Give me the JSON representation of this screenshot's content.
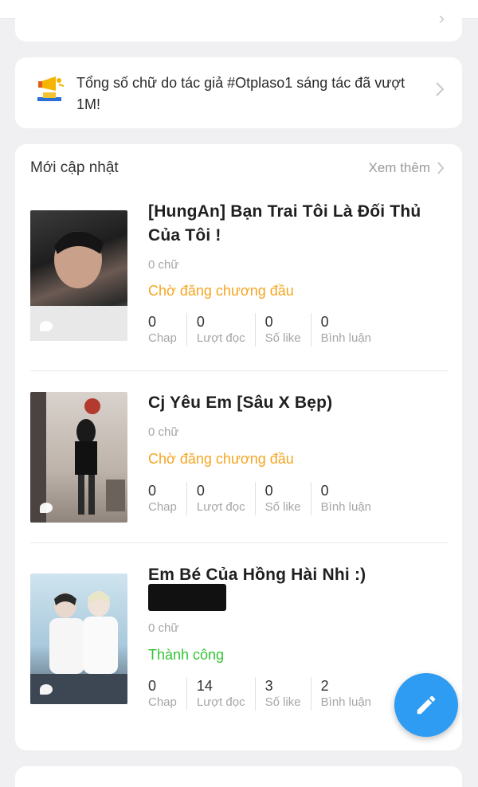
{
  "announcement": {
    "text": "Tổng số chữ do tác giả #Otplaso1 sáng tác đã vượt 1M!"
  },
  "updates": {
    "heading": "Mới cập nhật",
    "see_more": "Xem thêm"
  },
  "stat_labels": {
    "chap": "Chap",
    "reads": "Lượt đọc",
    "likes": "Số like",
    "comments": "Bình luận"
  },
  "stories": [
    {
      "title": "[HungAn] Bạn Trai Tôi Là Đối Thủ Của Tôi !",
      "words": "0 chữ",
      "status": "Chờ đăng chương đầu",
      "chap": "0",
      "reads": "0",
      "likes": "0",
      "comments": "0"
    },
    {
      "title": "Cj Yêu Em [Sâu X Bẹp)",
      "words": "0 chữ",
      "status": "Chờ đăng chương đầu",
      "chap": "0",
      "reads": "0",
      "likes": "0",
      "comments": "0"
    },
    {
      "title": "Em Bé Của Hồng Hài Nhi :)",
      "words": "0 chữ",
      "status": "Thành công",
      "chap": "0",
      "reads": "14",
      "likes": "3",
      "comments": "2"
    }
  ],
  "colors": {
    "pending": "#f5a623",
    "success": "#35c435",
    "fab": "#2e9cf2"
  },
  "icons": {
    "announcement": "megaphone-trophy-icon",
    "chevron": "chevron-right-icon",
    "fab": "pencil-icon",
    "comment": "comment-bubble-icon"
  }
}
